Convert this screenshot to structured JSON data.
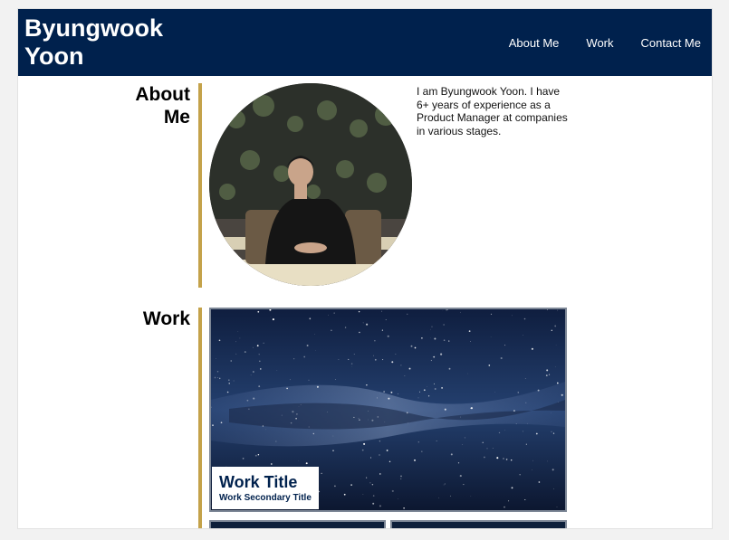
{
  "header": {
    "title": "Byungwook Yoon",
    "nav": [
      "About Me",
      "Work",
      "Contact Me"
    ]
  },
  "about": {
    "heading": "About Me",
    "text": "I am Byungwook Yoon. I have 6+ years of experience as a Product Manager at companies in various stages.",
    "photo_icon": "profile-photo"
  },
  "work": {
    "heading": "Work",
    "card": {
      "title": "Work Title",
      "subtitle": "Work Secondary Title",
      "image_icon": "starry-sky-image"
    }
  },
  "colors": {
    "header_bg": "#00214d",
    "accent_rule": "#c4a24a",
    "card_border": "#7d8796"
  }
}
